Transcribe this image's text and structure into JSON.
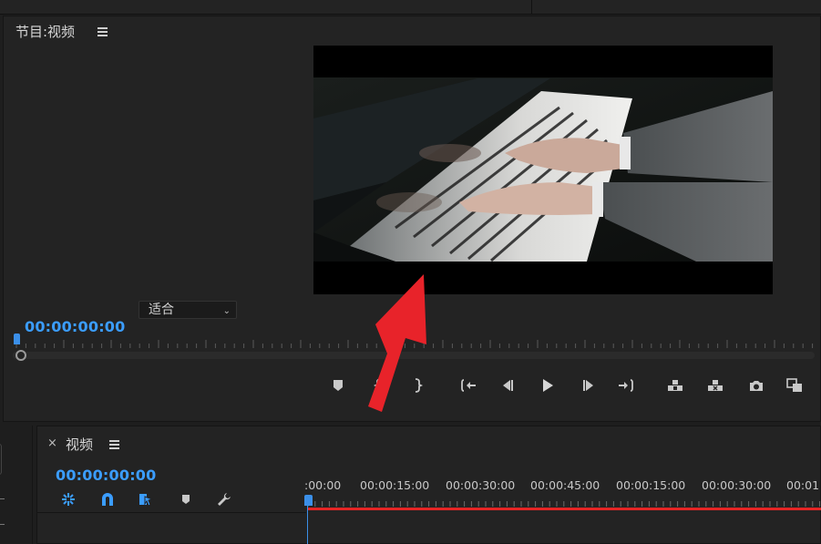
{
  "program_monitor": {
    "title": "节目:视频",
    "timecode": "00:00:00:00",
    "fit_value": "适合"
  },
  "timeline": {
    "title": "视频",
    "close_glyph": "×",
    "timecode": "00:00:00:00",
    "ruler_labels": [
      ":00:00",
      "00:00:15:00",
      "00:00:30:00",
      "00:00:45:00",
      "00:00:15:00",
      "00:00:30:00",
      "00:01"
    ]
  },
  "transport_icons": [
    "add-marker-icon",
    "mark-in-icon",
    "mark-out-icon",
    "go-to-in-icon",
    "step-back-icon",
    "play-icon",
    "step-forward-icon",
    "go-to-out-icon",
    "lift-icon",
    "extract-icon",
    "export-frame-icon",
    "compare-view-icon"
  ],
  "timeline_tool_icons": [
    "nest-sequence-icon",
    "snap-magnet-icon",
    "linked-selection-icon",
    "add-marker-icon",
    "wrench-settings-icon"
  ],
  "colors": {
    "timecode": "#3b9dff",
    "playhead": "#3b8fe8",
    "work_area_bar": "#e52525",
    "annotation_arrow": "#e8232a",
    "panel_bg": "#232323"
  }
}
